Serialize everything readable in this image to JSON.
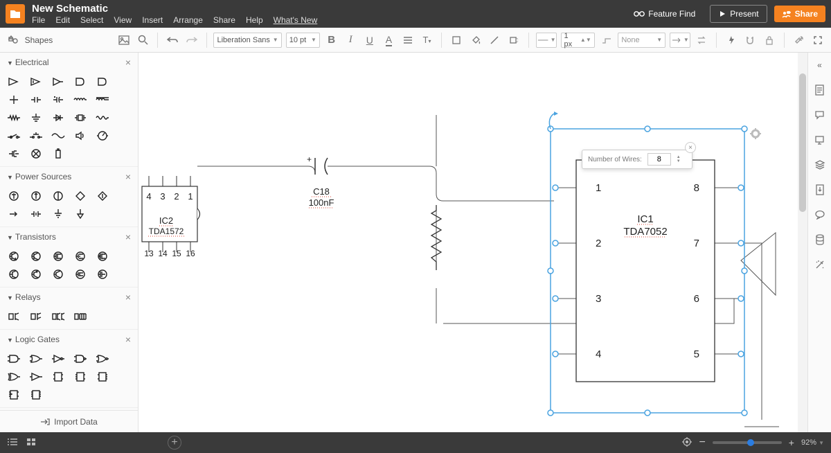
{
  "header": {
    "title": "New Schematic",
    "menus": [
      "File",
      "Edit",
      "Select",
      "View",
      "Insert",
      "Arrange",
      "Share",
      "Help",
      "What's New"
    ],
    "feature_find": "Feature Find",
    "present": "Present",
    "share": "Share"
  },
  "toolbar": {
    "shapes": "Shapes",
    "font": "Liberation Sans",
    "font_size": "10 pt",
    "stroke": "1 px",
    "line_end": "None"
  },
  "left": {
    "cats": {
      "electrical": "Electrical",
      "power": "Power Sources",
      "transistors": "Transistors",
      "relays": "Relays",
      "logic": "Logic Gates"
    },
    "import": "Import Data"
  },
  "canvas": {
    "ic1": {
      "name": "IC1",
      "part": "TDA7052",
      "pins_left": [
        "1",
        "2",
        "3",
        "4"
      ],
      "pins_right": [
        "8",
        "7",
        "6",
        "5"
      ]
    },
    "ic2": {
      "name": "IC2",
      "part": "TDA1572",
      "pins_top": [
        "4",
        "3",
        "2",
        "1"
      ],
      "pins_bot": [
        "13",
        "14",
        "15",
        "16"
      ]
    },
    "cap": {
      "ref": "C18",
      "val": "100nF",
      "polarity": "+"
    },
    "wires_panel": {
      "label": "Number of Wires:",
      "value": "8"
    }
  },
  "bottom": {
    "zoom": "92%"
  }
}
